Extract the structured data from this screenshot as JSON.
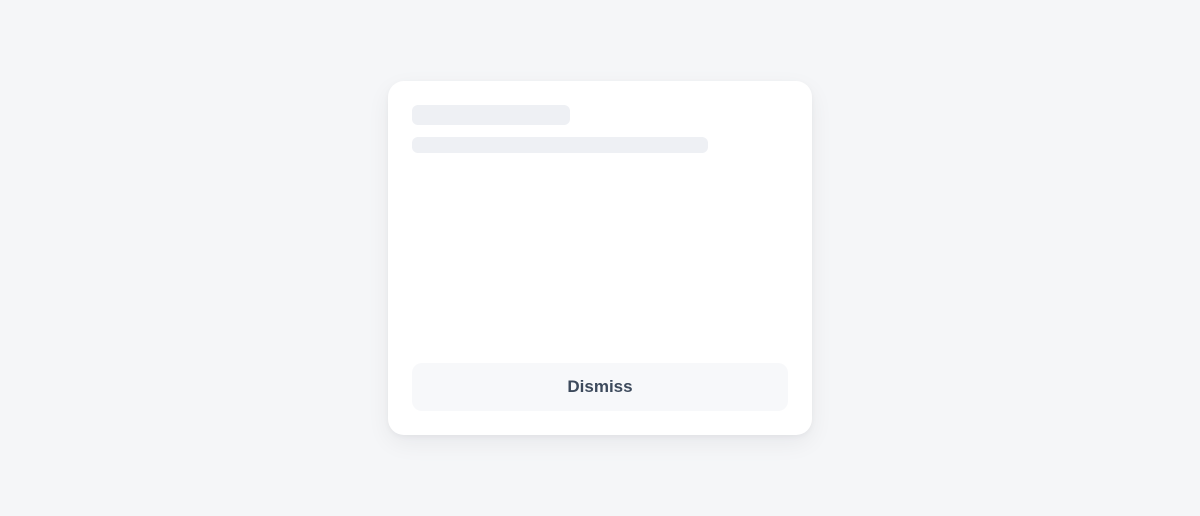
{
  "modal": {
    "dismiss_label": "Dismiss"
  }
}
